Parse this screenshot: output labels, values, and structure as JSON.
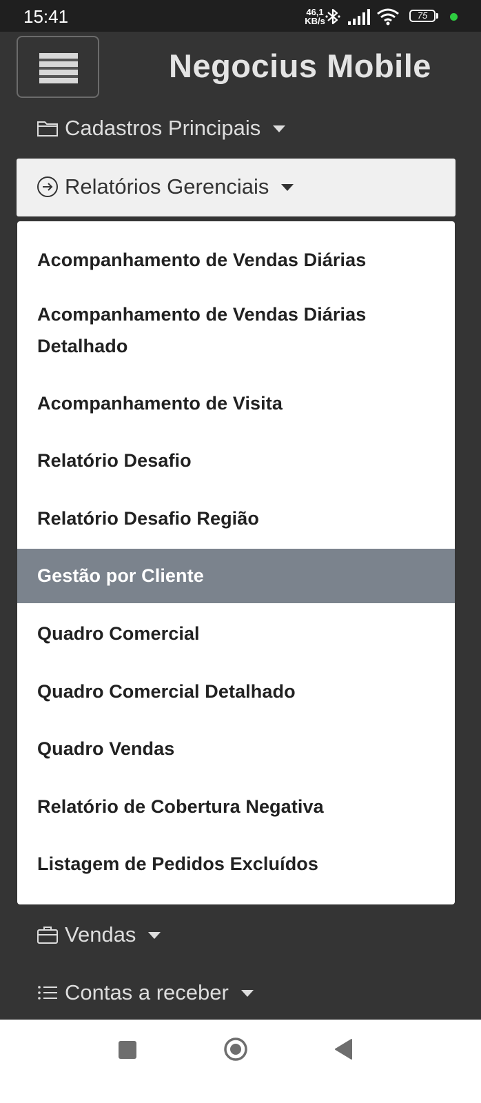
{
  "status_bar": {
    "time": "15:41",
    "speed_value": "46,1",
    "speed_unit": "KB/s",
    "battery_level": "75",
    "icons": [
      "bluetooth-icon",
      "signal-icon",
      "wifi-icon",
      "battery-icon"
    ]
  },
  "header": {
    "menu_icon": "hamburger-icon",
    "title": "Negocius Mobile"
  },
  "nav": {
    "cadastros": "Cadastros Principais",
    "relatorios": "Relatórios Gerenciais",
    "vendas": "Vendas",
    "contas": "Contas a receber"
  },
  "dropdown": {
    "selected_index": 5,
    "items": [
      "Acompanhamento de Vendas Diárias",
      "Acompanhamento de Vendas Diárias Detalhado",
      "Acompanhamento de Visita",
      "Relatório Desafio",
      "Relatório Desafio Região",
      "Gestão por Cliente",
      "Quadro Comercial",
      "Quadro Comercial Detalhado",
      "Quadro Vendas",
      "Relatório de Cobertura Negativa",
      "Listagem de Pedidos Excluídos"
    ]
  },
  "colors": {
    "background": "#343434",
    "selected_item": "#7b838d",
    "status_dot": "#2ecc40"
  }
}
